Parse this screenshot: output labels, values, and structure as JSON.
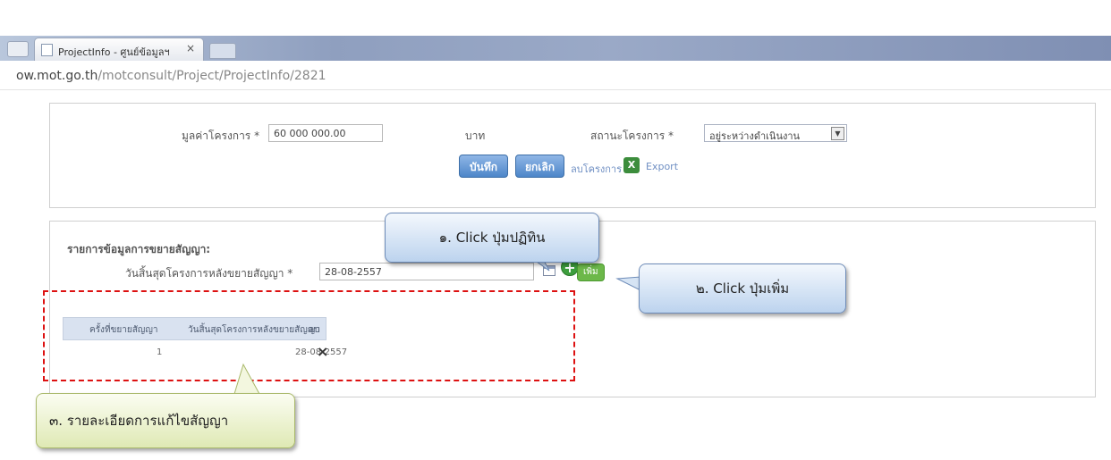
{
  "browser": {
    "tab_title": "ProjectInfo - ศูนย์ข้อมูลฯ",
    "tab_close": "×",
    "url_host": "ow.mot.go.th",
    "url_path": "/motconsult/Project/ProjectInfo/2821"
  },
  "project_form": {
    "budget_label": "มูลค่าโครงการ *",
    "budget_value": "60 000 000.00",
    "budget_unit": "บาท",
    "status_label": "สถานะโครงการ *",
    "status_value": "อยู่ระหว่างดำเนินงาน",
    "save_button": "บันทึก",
    "cancel_button": "ยกเลิก",
    "delete_link": "ลบโครงการ",
    "export_link": "Export"
  },
  "extension_section": {
    "title": "รายการข้อมูลการขยายสัญญา:",
    "end_date_label": "วันสิ้นสุดโครงการหลังขยายสัญญา *",
    "end_date_value": "28-08-2557",
    "add_button": "เพิ่ม",
    "table": {
      "headers": [
        "ครั้งที่ขยายสัญญา",
        "วันสิ้นสุดโครงการหลังขยายสัญญา",
        "ลบ"
      ],
      "rows": [
        {
          "no": "1",
          "date": "28-08-2557",
          "delete": "×"
        }
      ]
    }
  },
  "callouts": {
    "step1": "๑. Click ปุ่มปฏิทิน",
    "step2": "๒. Click ปุ่มเพิ่ม",
    "step3": "๓. รายละเอียดการแก้ไขสัญญา"
  },
  "icons": {
    "calendar": "calendar-icon",
    "add": "plus-circle-icon",
    "excel": "excel-icon",
    "delete": "close-icon"
  },
  "colors": {
    "highlight_border": "#dd1111",
    "button_blue": "#4d86c9",
    "add_green": "#6cb84a"
  }
}
